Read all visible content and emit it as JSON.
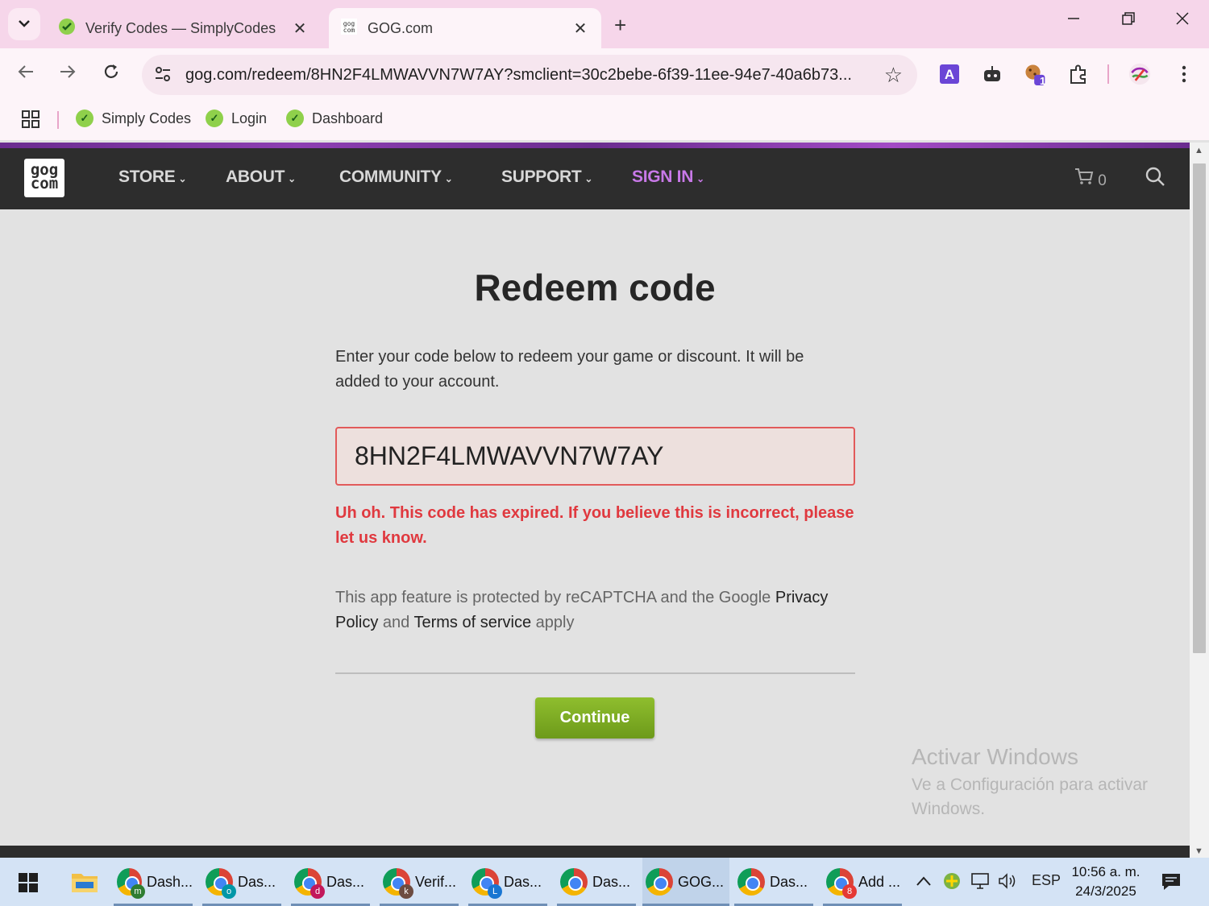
{
  "browser": {
    "tabs": [
      {
        "title": "Verify Codes — SimplyCodes",
        "icon": "simplycodes-icon",
        "active": false
      },
      {
        "title": "GOG.com",
        "icon": "gog-icon",
        "active": true
      }
    ],
    "new_tab": "+",
    "address": "gog.com/redeem/8HN2F4LMWAVVN7W7AY?smclient=30c2bebe-6f39-11ee-94e7-40a6b73...",
    "extension_badge": "1",
    "bookmarks": [
      {
        "label": "Simply Codes"
      },
      {
        "label": "Login"
      },
      {
        "label": "Dashboard"
      }
    ]
  },
  "gog": {
    "logo_line1": "gog",
    "logo_line2": "com",
    "nav": [
      "STORE",
      "ABOUT",
      "COMMUNITY",
      "SUPPORT",
      "SIGN IN"
    ],
    "cart_count": "0",
    "accent_color": "#c879e8"
  },
  "redeem": {
    "heading": "Redeem code",
    "intro": "Enter your code below to redeem your game or discount. It will be added to your account.",
    "code_value": "8HN2F4LMWAVVN7W7AY",
    "error": "Uh oh. This code has expired. If you believe this is incorrect, please let us know.",
    "captcha_prefix": "This app feature is protected by reCAPTCHA and the Google ",
    "privacy_link": "Privacy Policy",
    "captcha_and": " and ",
    "terms_link": "Terms of service",
    "captcha_suffix": " apply",
    "continue_label": "Continue",
    "error_color": "#e0393f",
    "button_color": "#7dac24"
  },
  "watermark": {
    "line1": "Activar Windows",
    "line2": "Ve a Configuración para activar",
    "line3": "Windows."
  },
  "taskbar": {
    "apps": [
      {
        "label": "Dash...",
        "badge": "m",
        "badge_color": "#2e7d32"
      },
      {
        "label": "Das...",
        "badge": "o",
        "badge_color": "#0097a7"
      },
      {
        "label": "Das...",
        "badge": "d",
        "badge_color": "#c2185b"
      },
      {
        "label": "Verif...",
        "badge": "k",
        "badge_color": "#6d4c41"
      },
      {
        "label": "Das...",
        "badge": "L",
        "badge_color": "#1976d2"
      },
      {
        "label": "Das...",
        "badge": "",
        "badge_color": ""
      },
      {
        "label": "GOG...",
        "badge": "",
        "badge_color": ""
      },
      {
        "label": "Das...",
        "badge": "",
        "badge_color": ""
      },
      {
        "label": "Add ...",
        "badge": "8",
        "badge_color": "#e53935"
      }
    ],
    "language": "ESP",
    "time": "10:56 a. m.",
    "date": "24/3/2025"
  }
}
